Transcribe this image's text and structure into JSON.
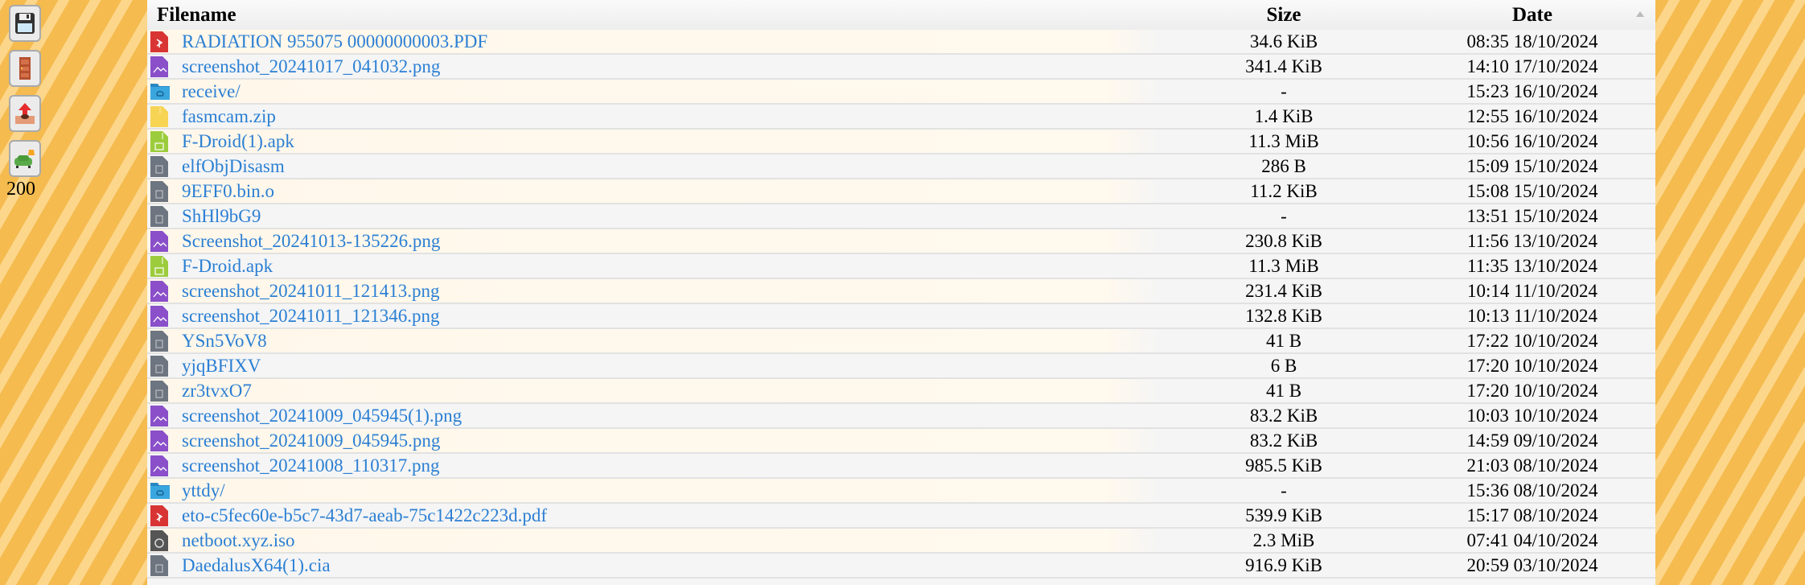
{
  "sidebar": {
    "buttons": [
      {
        "icon": "save-icon"
      },
      {
        "icon": "door-exit-icon"
      },
      {
        "icon": "upload-icon"
      },
      {
        "icon": "armchair-lamp-icon"
      }
    ],
    "count": "200"
  },
  "table": {
    "headers": {
      "filename": "Filename",
      "size": "Size",
      "date": "Date"
    },
    "sort": "date-descending",
    "rows": [
      {
        "name": "RADIATION 955075 00000000003.PDF",
        "size": "34.6 KiB",
        "date": "08:35 18/10/2024",
        "type": "pdf"
      },
      {
        "name": "screenshot_20241017_041032.png",
        "size": "341.4 KiB",
        "date": "14:10 17/10/2024",
        "type": "image"
      },
      {
        "name": "receive/",
        "size": "-",
        "date": "15:23 16/10/2024",
        "type": "folder"
      },
      {
        "name": "fasmcam.zip",
        "size": "1.4 KiB",
        "date": "12:55 16/10/2024",
        "type": "zip"
      },
      {
        "name": "F-Droid(1).apk",
        "size": "11.3 MiB",
        "date": "10:56 16/10/2024",
        "type": "apk"
      },
      {
        "name": "elfObjDisasm",
        "size": "286 B",
        "date": "15:09 15/10/2024",
        "type": "unknown"
      },
      {
        "name": "9EFF0.bin.o",
        "size": "11.2 KiB",
        "date": "15:08 15/10/2024",
        "type": "unknown"
      },
      {
        "name": "ShHl9bG9",
        "size": "-",
        "date": "13:51 15/10/2024",
        "type": "unknown"
      },
      {
        "name": "Screenshot_20241013-135226.png",
        "size": "230.8 KiB",
        "date": "11:56 13/10/2024",
        "type": "image"
      },
      {
        "name": "F-Droid.apk",
        "size": "11.3 MiB",
        "date": "11:35 13/10/2024",
        "type": "apk"
      },
      {
        "name": "screenshot_20241011_121413.png",
        "size": "231.4 KiB",
        "date": "10:14 11/10/2024",
        "type": "image"
      },
      {
        "name": "screenshot_20241011_121346.png",
        "size": "132.8 KiB",
        "date": "10:13 11/10/2024",
        "type": "image"
      },
      {
        "name": "YSn5VoV8",
        "size": "41 B",
        "date": "17:22 10/10/2024",
        "type": "unknown"
      },
      {
        "name": "yjqBFIXV",
        "size": "6 B",
        "date": "17:20 10/10/2024",
        "type": "unknown"
      },
      {
        "name": "zr3tvxO7",
        "size": "41 B",
        "date": "17:20 10/10/2024",
        "type": "unknown"
      },
      {
        "name": "screenshot_20241009_045945(1).png",
        "size": "83.2 KiB",
        "date": "10:03 10/10/2024",
        "type": "image"
      },
      {
        "name": "screenshot_20241009_045945.png",
        "size": "83.2 KiB",
        "date": "14:59 09/10/2024",
        "type": "image"
      },
      {
        "name": "screenshot_20241008_110317.png",
        "size": "985.5 KiB",
        "date": "21:03 08/10/2024",
        "type": "image"
      },
      {
        "name": "yttdy/",
        "size": "-",
        "date": "15:36 08/10/2024",
        "type": "folder"
      },
      {
        "name": "eto-c5fec60e-b5c7-43d7-aeab-75c1422c223d.pdf",
        "size": "539.9 KiB",
        "date": "15:17 08/10/2024",
        "type": "pdf"
      },
      {
        "name": "netboot.xyz.iso",
        "size": "2.3 MiB",
        "date": "07:41 04/10/2024",
        "type": "disc"
      },
      {
        "name": "DaedalusX64(1).cia",
        "size": "916.9 KiB",
        "date": "20:59 03/10/2024",
        "type": "unknown"
      }
    ]
  },
  "colors": {
    "link": "#2b7fd3",
    "pdf": "#d93434",
    "image": "#8a4fc9",
    "folder": "#3aa6e0",
    "zip": "#f7d454",
    "apk": "#9ccc3c",
    "unknown": "#6d7580",
    "disc": "#555555"
  }
}
